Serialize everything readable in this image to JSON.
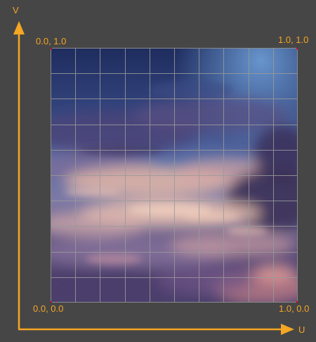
{
  "axes": {
    "u_label": "U",
    "v_label": "V"
  },
  "corners": {
    "top_left": "0.0, 1.0",
    "top_right": "1.0, 1.0",
    "bottom_left": "0.0, 0.0",
    "bottom_right": "1.0, 0.0"
  },
  "colors": {
    "background": "#464646",
    "axis": "#f5a623",
    "grid": "#9a9a9a",
    "corner_marker": "#d0021b",
    "sky_top": "#1f2f63",
    "sky_mid": "#3d5a9a",
    "cloud_light": "#e7b9a4",
    "cloud_pink": "#c98a90",
    "cloud_purple": "#5b4a77",
    "cloud_dark": "#3a2f55"
  },
  "texture": {
    "subject": "sunset-cloud-sky-image",
    "grid_divisions": 10
  }
}
